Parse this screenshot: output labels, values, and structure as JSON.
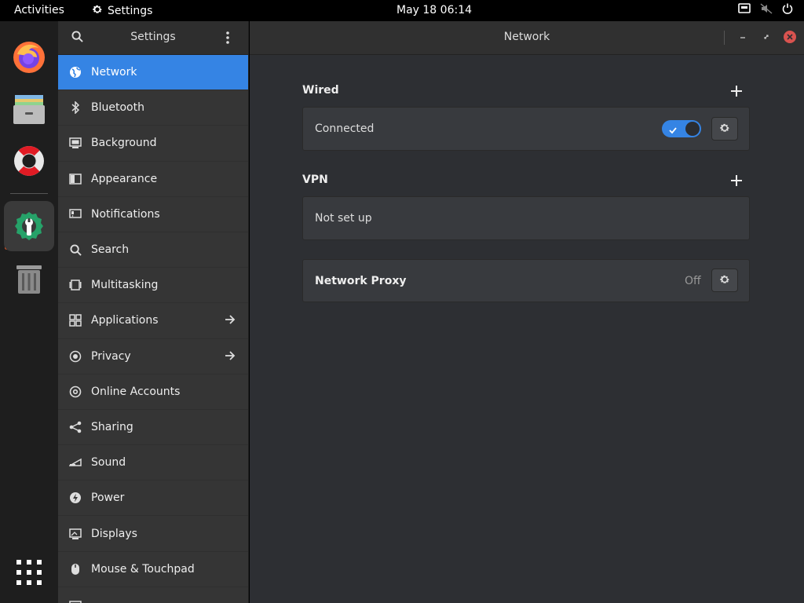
{
  "topbar": {
    "activities": "Activities",
    "app_name": "Settings",
    "clock": "May 18  06:14"
  },
  "dock": {
    "items": [
      "firefox-icon",
      "files-icon",
      "help-icon",
      "settings-icon",
      "trash-icon",
      "app-grid-icon"
    ],
    "accent": "#e95420"
  },
  "sidebar": {
    "title": "Settings",
    "items": [
      {
        "label": "Network"
      },
      {
        "label": "Bluetooth"
      },
      {
        "label": "Background"
      },
      {
        "label": "Appearance"
      },
      {
        "label": "Notifications"
      },
      {
        "label": "Search"
      },
      {
        "label": "Multitasking"
      },
      {
        "label": "Applications"
      },
      {
        "label": "Privacy"
      },
      {
        "label": "Online Accounts"
      },
      {
        "label": "Sharing"
      },
      {
        "label": "Sound"
      },
      {
        "label": "Power"
      },
      {
        "label": "Displays"
      },
      {
        "label": "Mouse & Touchpad"
      }
    ],
    "selected_color": "#3584e4"
  },
  "main": {
    "title": "Network",
    "wired": {
      "title": "Wired",
      "status": "Connected",
      "enabled": true
    },
    "vpn": {
      "title": "VPN",
      "status": "Not set up"
    },
    "proxy": {
      "title": "Network Proxy",
      "status": "Off"
    }
  }
}
